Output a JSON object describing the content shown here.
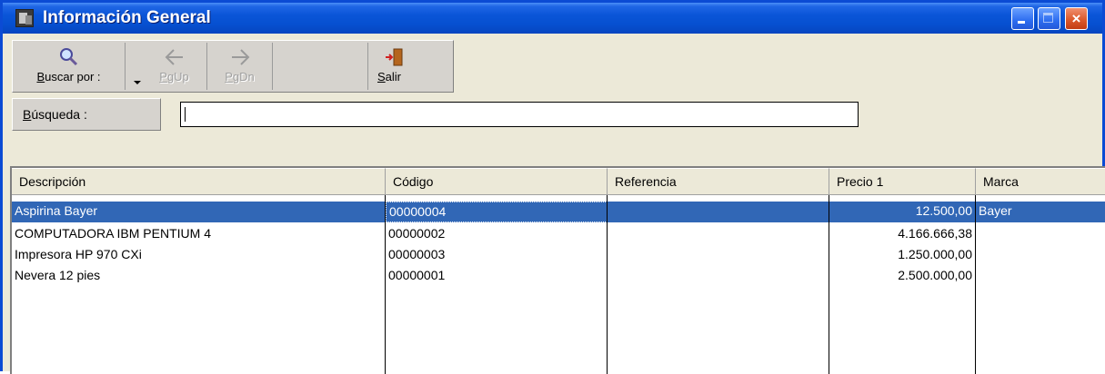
{
  "window": {
    "title": "Información General",
    "controls": {
      "minimize": "minimize-icon",
      "maximize": "maximize-icon",
      "close": "×"
    }
  },
  "toolbar": {
    "buscar_label_u": "B",
    "buscar_label_rest": "uscar por :",
    "pgup_label_u": "P",
    "pgup_label_rest": "gUp",
    "pgdn_label_u": "P",
    "pgdn_label_rest": "gDn",
    "salir_label_u": "S",
    "salir_label_rest": "alir"
  },
  "search": {
    "label_u": "B",
    "label_rest": "úsqueda :",
    "value": ""
  },
  "table": {
    "columns": [
      "Descripción",
      "Código",
      "Referencia",
      "Precio 1",
      "Marca"
    ],
    "rows": [
      {
        "descripcion": "Aspirina Bayer",
        "codigo": "00000004",
        "referencia": "",
        "precio": "12.500,00",
        "marca": "Bayer",
        "selected": true
      },
      {
        "descripcion": "COMPUTADORA IBM PENTIUM 4",
        "codigo": "00000002",
        "referencia": "",
        "precio": "4.166.666,38",
        "marca": ""
      },
      {
        "descripcion": "Impresora HP 970 CXi",
        "codigo": "00000003",
        "referencia": "",
        "precio": "1.250.000,00",
        "marca": ""
      },
      {
        "descripcion": "Nevera 12 pies",
        "codigo": "00000001",
        "referencia": "",
        "precio": "2.500.000,00",
        "marca": ""
      }
    ]
  },
  "colors": {
    "titlebar": "#0a55d8",
    "selection": "#3167b6",
    "face": "#ece9d8"
  }
}
